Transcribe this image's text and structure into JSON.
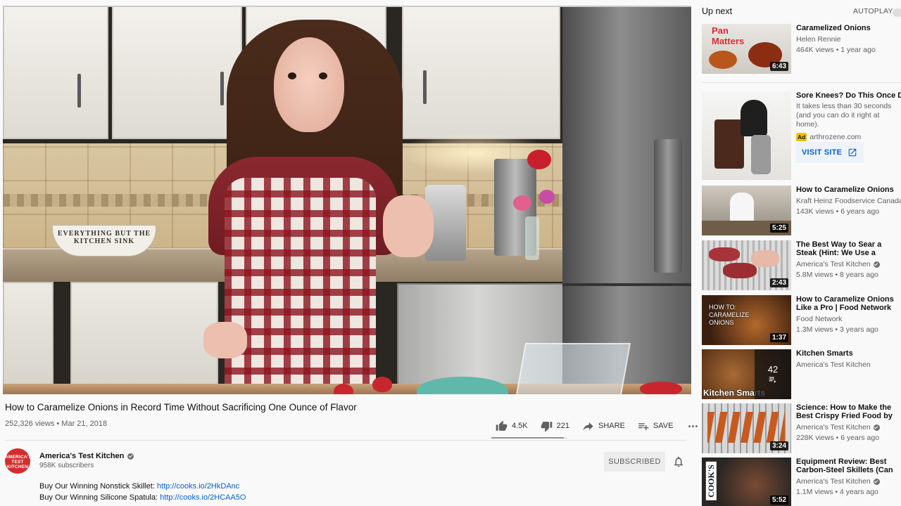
{
  "video": {
    "title": "How to Caramelize Onions in Record Time Without Sacrificing One Ounce of Flavor",
    "meta": "252,326 views • Mar 21, 2018",
    "likes": "4.5K",
    "dislikes": "221",
    "share_label": "SHARE",
    "save_label": "SAVE",
    "like_ratio": 0.95,
    "scene_sign_text": "EVERYTHING BUT THE KITCHEN SINK"
  },
  "channel": {
    "name": "America's Test Kitchen",
    "subscribers": "958K subscribers",
    "avatar_text": "AMERICA'S TEST KITCHEN",
    "subscribe_label": "SUBSCRIBED"
  },
  "description": [
    {
      "text": "Buy Our Winning Nonstick Skillet: ",
      "link": "http://cooks.io/2HkDAnc"
    },
    {
      "text": "Buy Our Winning Silicone Spatula: ",
      "link": "http://cooks.io/2HCAA5O"
    }
  ],
  "sidebar": {
    "up_next": "Up next",
    "autoplay": "AUTOPLAY",
    "items": [
      {
        "title": "Caramelized Onions",
        "channel": "Helen Rennie",
        "meta": "464K views • 1 year ago",
        "duration": "6:43",
        "thumb_text": "Pan Matters"
      },
      {
        "title": "Sore Knees? Do This Once Daily",
        "description": "It takes less than 30 seconds (and you can do it right at home).",
        "ad_label": "Ad",
        "domain": "arthrozene.com",
        "visit_label": "VISIT SITE"
      },
      {
        "title": "How to Caramelize Onions",
        "channel": "Kraft Heinz Foodservice Canada",
        "meta": "143K views • 6 years ago",
        "duration": "5:25"
      },
      {
        "title": "The Best Way to Sear a Steak (Hint: We Use a Secret...",
        "channel": "America's Test Kitchen",
        "meta": "5.8M views • 8 years ago",
        "duration": "2:43"
      },
      {
        "title": "How to Caramelize Onions Like a Pro | Food Network",
        "channel": "Food Network",
        "meta": "1.3M views • 3 years ago",
        "duration": "1:37",
        "thumb_text": "HOW TO: CARAMELIZE ONIONS"
      },
      {
        "title": "Kitchen Smarts",
        "channel": "America's Test Kitchen",
        "playlist_count": "42",
        "thumb_text": "Kitchen Smarts"
      },
      {
        "title": "Science: How to Make the Best Crispy Fried Food by Being...",
        "channel": "America's Test Kitchen",
        "meta": "228K views • 6 years ago",
        "duration": "3:24"
      },
      {
        "title": "Equipment Review: Best Carbon-Steel Skillets (Can Thi...",
        "channel": "America's Test Kitchen",
        "meta": "1.1M views • 4 years ago",
        "duration": "5:52",
        "thumb_text": "COOK'S"
      }
    ]
  },
  "colors": {
    "link": "#065fd4",
    "ad_badge": "#f2c400",
    "channel_avatar": "#d42d2d"
  }
}
